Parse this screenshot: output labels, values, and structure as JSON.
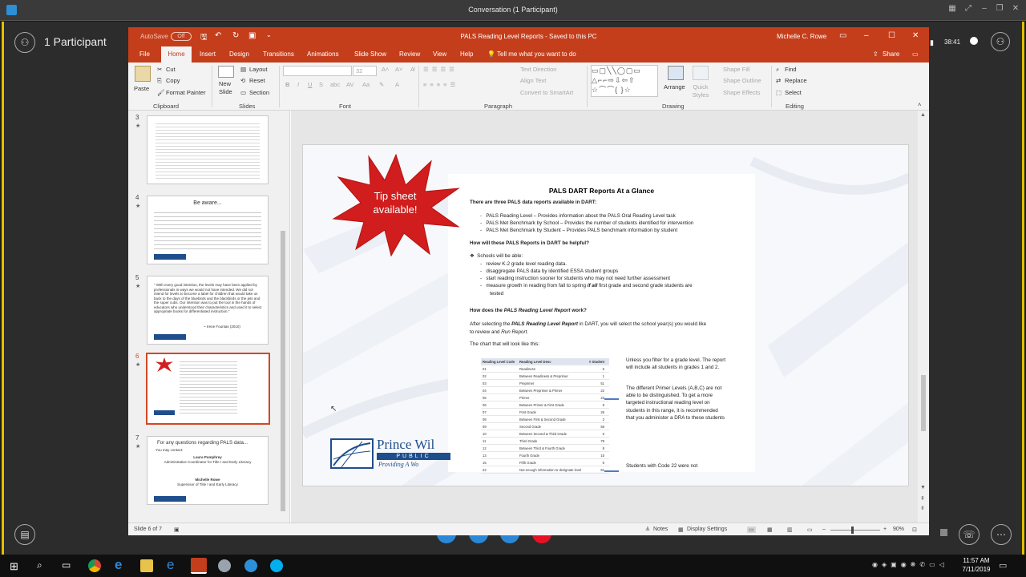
{
  "skype": {
    "window_title": "Conversation (1 Participant)",
    "participants_label": "1 Participant",
    "call_time": "38:41"
  },
  "ppt": {
    "autosave_label": "AutoSave",
    "autosave_state": "Off",
    "title": "PALS Reading Level Reports  -  Saved to this PC",
    "user": "Michelle C. Rowe",
    "tabs": [
      "File",
      "Home",
      "Insert",
      "Design",
      "Transitions",
      "Animations",
      "Slide Show",
      "Review",
      "View",
      "Help"
    ],
    "tell_me": "Tell me what you want to do",
    "share": "Share",
    "ribbon": {
      "paste": "Paste",
      "cut": "Cut",
      "copy": "Copy",
      "format_painter": "Format Painter",
      "clipboard": "Clipboard",
      "new_slide": "New Slide",
      "layout": "Layout",
      "reset": "Reset",
      "section": "Section",
      "slides": "Slides",
      "font_size": "32",
      "font": "Font",
      "text_direction": "Text Direction",
      "align_text": "Align Text",
      "convert_smartart": "Convert to SmartArt",
      "paragraph": "Paragraph",
      "arrange": "Arrange",
      "quick_styles": "Quick Styles",
      "shape_fill": "Shape Fill",
      "shape_outline": "Shape Outline",
      "shape_effects": "Shape Effects",
      "drawing": "Drawing",
      "find": "Find",
      "replace": "Replace",
      "select": "Select",
      "editing": "Editing"
    },
    "thumbs": {
      "t3": {
        "num": "3"
      },
      "t4": {
        "num": "4",
        "title": "Be aware..."
      },
      "t5": {
        "num": "5",
        "quote": "\" With every good intention, the levels may have been applied by professionals in ways we would not have intended. We did not intend for levels to become a label for children that would take us back to the days of the bluebirds and the blackbirds or the jets and the super cubs. Our intention was to put the tool in the hands of educators who understood their characteristics and used it to select appropriate books for differentiated instruction.\"",
        "author": "~ Irene Fountas (2010)"
      },
      "t6": {
        "num": "6"
      },
      "t7": {
        "num": "7",
        "title": "For any questions regarding PALS data...",
        "contact": "You may contact:",
        "name1": "Laura Pumphrey",
        "role1": "Administrative Coordinator for Title I and Early Literacy",
        "name2": "Michelle Rowe",
        "role2": "Supervisor of Title I and Early Literacy"
      }
    },
    "slide": {
      "tip_line1": "Tip sheet",
      "tip_line2": "available!",
      "doc_title": "PALS DART Reports At a Glance",
      "intro": "There are three PALS data reports available in DART:",
      "r1": "PALS Reading Level – Provides information about the PALS Oral Reading Level task",
      "r2": "PALS Met Benchmark by School – Provides the number of students identified for intervention",
      "r3": "PALS Met Benchmark by Student – Provides PALS benchmark information by student",
      "q1": "How will these PALS Reports in DART be helpful?",
      "able": "Schools will be able:",
      "a1": "review K-2 grade level reading data.",
      "a2": "disaggregate PALS data by identified ESSA student groups",
      "a3": "start reading instruction sooner for students who may not need further assessment",
      "a4a": "measure growth in reading from fall to spring",
      "a4b": "if all",
      "a4c": "first grade and second grade students are",
      "a4d": "tested",
      "q2a": "How does the",
      "q2b": "PALS Reading Level Report",
      "q2c": "work?",
      "p1a": "After selecting the",
      "p1b": "PALS Reading Level Report",
      "p1c": "in DART, you will select the school year(s) you would like",
      "p1d": "to review and",
      "p1e": "Run Report",
      "chart_line": "The chart that will look like this:",
      "note1": "Unless you filter for a grade level. The report will include all students in grades 1 and 2.",
      "note2": "The different Primer Levels (A,B,C) are not able to be distinguished. To get a more targeted instructional reading level on students in this range, it is recommended that you administer a DRA to these students",
      "note3": "Students with Code 22 were not",
      "logo_name": "Prince Wil",
      "logo_sub": "PUBLIC",
      "logo_tag": "Providing A Wo"
    },
    "table": {
      "headers": [
        "Reading Level Code",
        "Reading Level Desc",
        "# Student"
      ],
      "rows": [
        [
          "01",
          "Readiness",
          "6"
        ],
        [
          "02",
          "Between Readiness & Preprimer",
          "1"
        ],
        [
          "03",
          "Preprimer",
          "51"
        ],
        [
          "04",
          "Between Preprimer & Primer",
          "22"
        ],
        [
          "05",
          "Primer",
          "23"
        ],
        [
          "06",
          "Between Primer & First Grade",
          "8"
        ],
        [
          "07",
          "First Grade",
          "26"
        ],
        [
          "08",
          "Between First & Second Grade",
          "2"
        ],
        [
          "09",
          "Second Grade",
          "58"
        ],
        [
          "10",
          "Between Second & Third Grade",
          "5"
        ],
        [
          "11",
          "Third Grade",
          "79"
        ],
        [
          "12",
          "Between Third & Fourth Grade",
          "8"
        ],
        [
          "13",
          "Fourth Grade",
          "15"
        ],
        [
          "15",
          "Fifth Grade",
          "6"
        ],
        [
          "22",
          "Not enough information to designate level",
          "61"
        ]
      ]
    },
    "status": {
      "slide_of": "Slide 6 of 7",
      "notes": "Notes",
      "display_settings": "Display Settings",
      "zoom": "90%"
    }
  },
  "taskbar": {
    "time": "11:57 AM",
    "date": "7/11/2019"
  }
}
